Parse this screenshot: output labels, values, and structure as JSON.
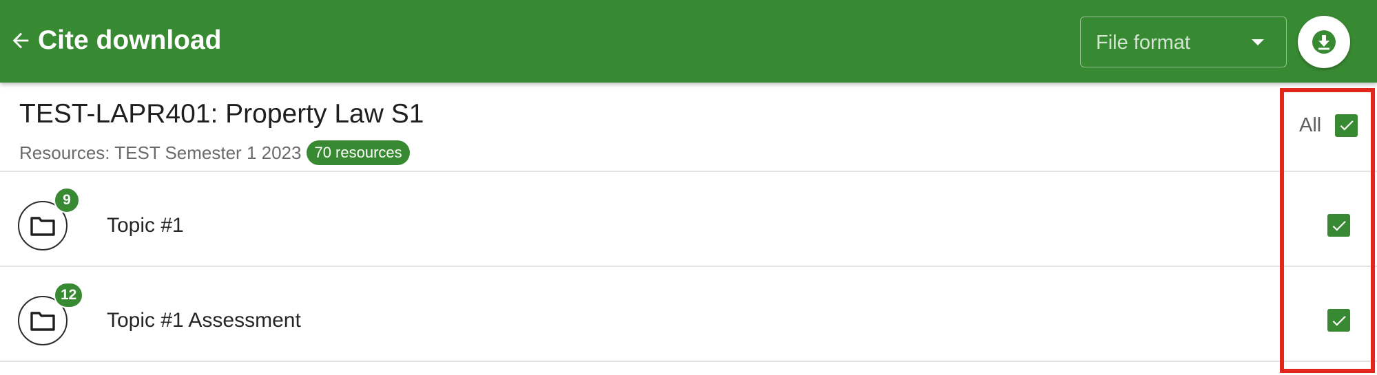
{
  "header": {
    "title": "Cite download",
    "back_icon": "arrow-left-icon",
    "format_select": {
      "label": "File format",
      "icon": "caret-down-icon"
    },
    "download_icon": "download-icon"
  },
  "course": {
    "title": "TEST-LAPR401: Property Law S1",
    "subtitle": "Resources: TEST Semester 1 2023",
    "resource_count": "70 resources",
    "select_all_label": "All",
    "select_all_checked": true
  },
  "topics": [
    {
      "label": "Topic #1",
      "count": "9",
      "checked": true,
      "icon": "folder-icon"
    },
    {
      "label": "Topic #1 Assessment",
      "count": "12",
      "checked": true,
      "icon": "folder-icon"
    }
  ],
  "colors": {
    "brand_green": "#388a32",
    "highlight_red": "#e1261c"
  }
}
